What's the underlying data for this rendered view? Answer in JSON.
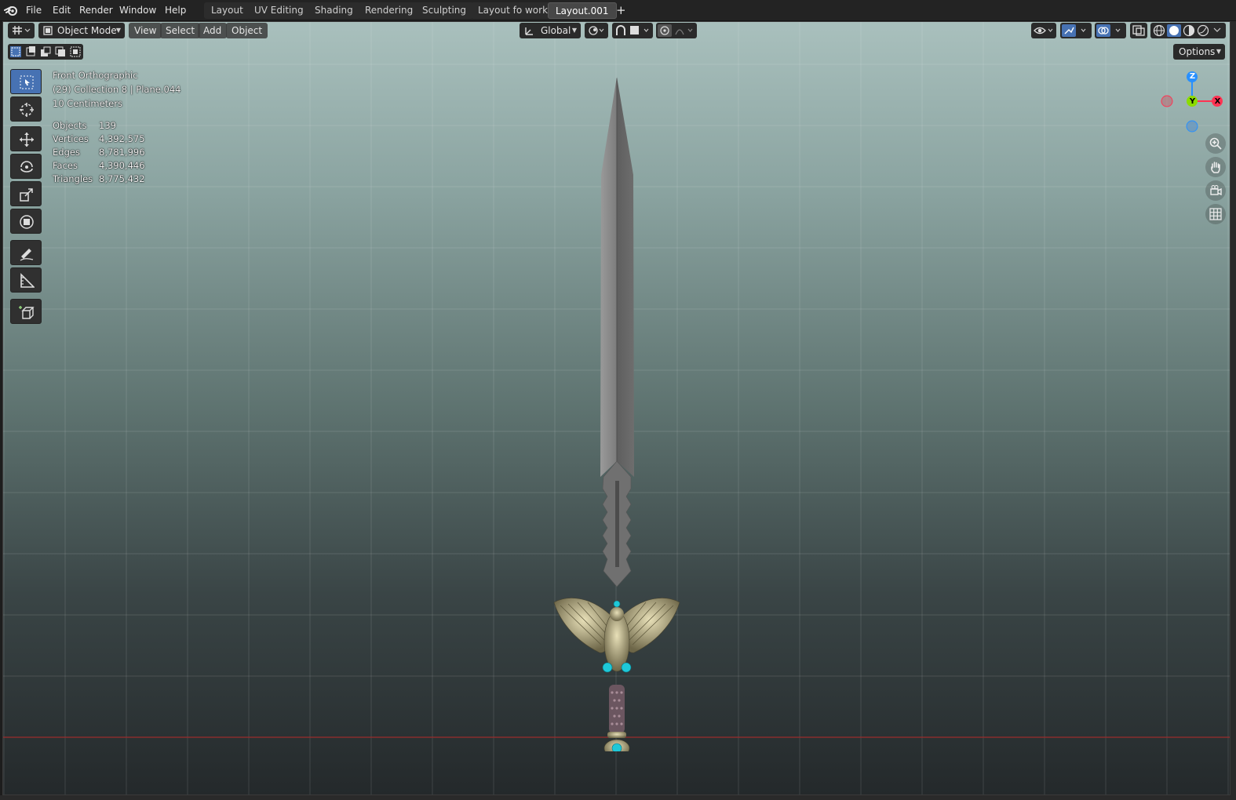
{
  "menubar": {
    "items": [
      "File",
      "Edit",
      "Render",
      "Window",
      "Help"
    ],
    "workspace_tabs": [
      "Layout",
      "UV Editing",
      "Shading",
      "Rendering",
      "Sculpting",
      "Layout fo work",
      "Layout.001"
    ],
    "active_tab": "Layout.001",
    "add_tab_label": "+"
  },
  "viewport_header": {
    "mode": "Object Mode",
    "menus": [
      "View",
      "Select",
      "Add",
      "Object"
    ],
    "transform_orientation": "Global",
    "options_label": "Options"
  },
  "overlay": {
    "view_name": "Front Orthographic",
    "collection": "(29) Collection 8 | Plane.044",
    "scale": "10 Centimeters",
    "stats": [
      {
        "label": "Objects",
        "value": "139"
      },
      {
        "label": "Vertices",
        "value": "4,392,575"
      },
      {
        "label": "Edges",
        "value": "8,781,996"
      },
      {
        "label": "Faces",
        "value": "4,390,446"
      },
      {
        "label": "Triangles",
        "value": "8,775,432"
      }
    ]
  },
  "gizmo": {
    "z": "Z",
    "y": "Y",
    "x": "X"
  },
  "colors": {
    "accent": "#4772b3",
    "axis_x": "#ff3352",
    "axis_y": "#8bdc00",
    "axis_z": "#2890ff",
    "gem": "#1ec8d8"
  },
  "tools": [
    "select-box-icon",
    "cursor-icon",
    "move-icon",
    "rotate-icon",
    "scale-icon",
    "transform-icon",
    "annotate-icon",
    "measure-icon",
    "add-cube-icon"
  ]
}
